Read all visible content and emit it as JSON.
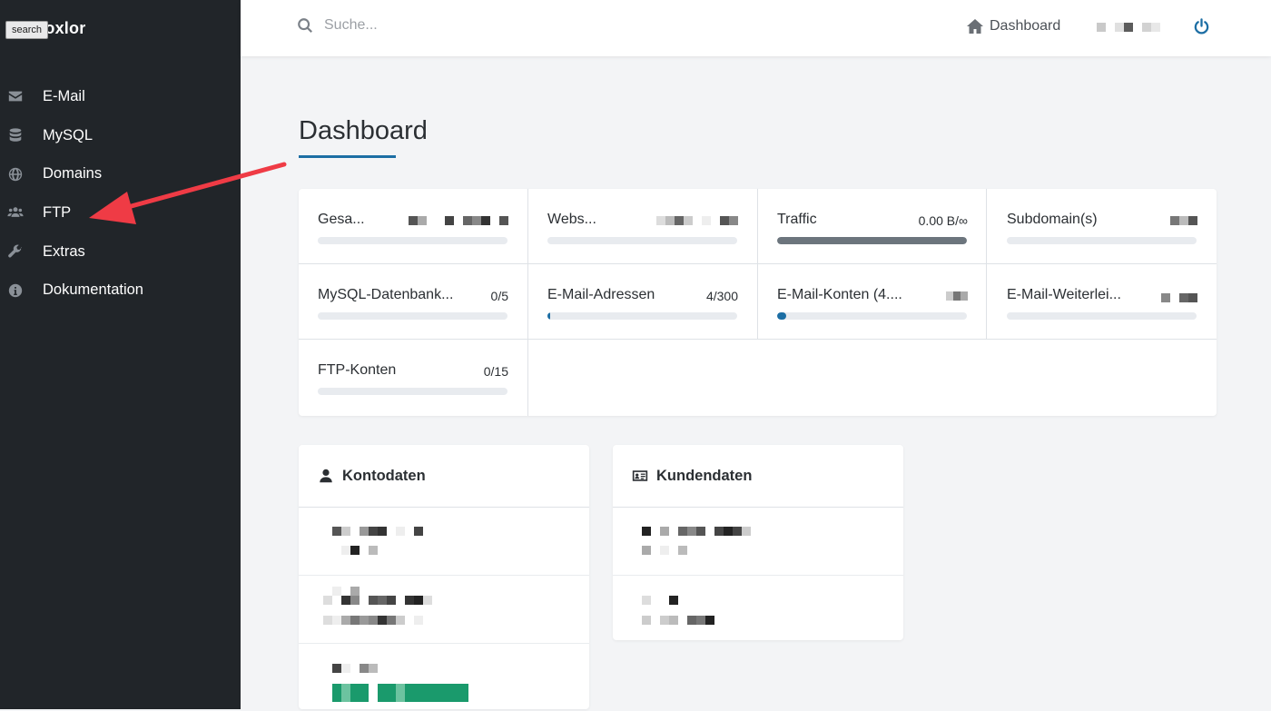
{
  "app": {
    "brand": "froxlor",
    "tooltip": "search"
  },
  "sidebar": {
    "items": [
      {
        "label": "E-Mail",
        "icon": "envelope-icon"
      },
      {
        "label": "MySQL",
        "icon": "database-icon"
      },
      {
        "label": "Domains",
        "icon": "globe-icon"
      },
      {
        "label": "FTP",
        "icon": "users-icon"
      },
      {
        "label": "Extras",
        "icon": "wrench-icon"
      },
      {
        "label": "Dokumentation",
        "icon": "info-circle-icon"
      }
    ]
  },
  "topbar": {
    "search_placeholder": "Suche...",
    "dashboard_link": "Dashboard"
  },
  "main": {
    "title": "Dashboard"
  },
  "stats": [
    {
      "label": "Gesa...",
      "value": "",
      "fill": 0,
      "fill_color": "#6c757d"
    },
    {
      "label": "Webs...",
      "value": "",
      "fill": 0,
      "fill_color": "#6c757d"
    },
    {
      "label": "Traffic",
      "value": "0.00 B/∞",
      "fill": 1.0,
      "fill_color": "#6c757d"
    },
    {
      "label": "Subdomain(s)",
      "value": "",
      "fill": 0,
      "fill_color": "#6c757d"
    },
    {
      "label": "MySQL-Datenbank...",
      "value": "0/5",
      "fill": 0,
      "fill_color": "#1c6ea4"
    },
    {
      "label": "E-Mail-Adressen",
      "value": "4/300",
      "fill": 0.013,
      "fill_color": "#1c6ea4"
    },
    {
      "label": "E-Mail-Konten (4....",
      "value": "",
      "fill": 0.05,
      "fill_color": "#1c6ea4"
    },
    {
      "label": "E-Mail-Weiterlei...",
      "value": "",
      "fill": 0,
      "fill_color": "#1c6ea4"
    },
    {
      "label": "FTP-Konten",
      "value": "0/15",
      "fill": 0,
      "fill_color": "#1c6ea4"
    }
  ],
  "cards": {
    "account": {
      "title": "Kontodaten",
      "icon": "user-icon"
    },
    "customer": {
      "title": "Kundendaten",
      "icon": "id-card-icon"
    }
  },
  "colors": {
    "sidebar_bg": "#212529",
    "accent": "#1c6ea4",
    "annotation_arrow": "#ef3b45"
  }
}
